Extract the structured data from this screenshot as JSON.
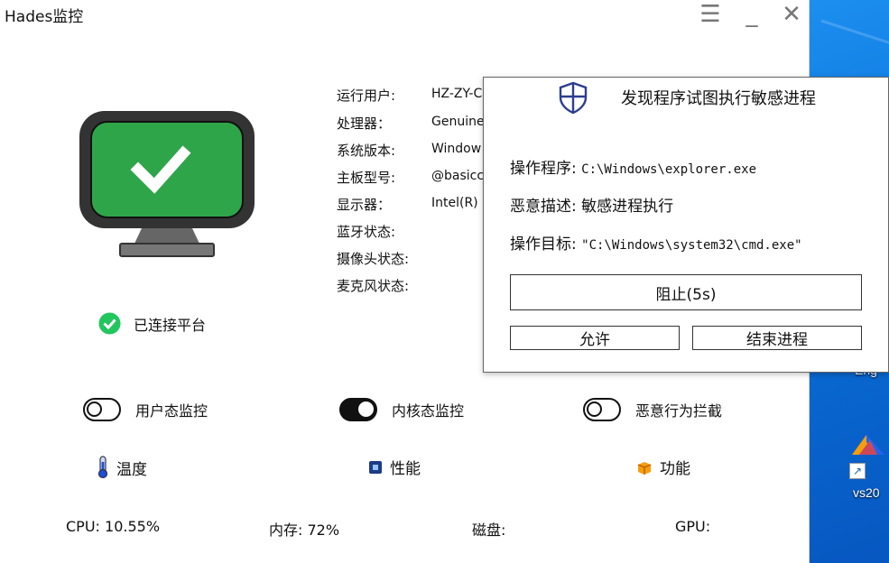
{
  "window": {
    "title": "Hades监控"
  },
  "window_controls": {
    "menu": "☰",
    "minimize": "_",
    "close": "✕"
  },
  "status": {
    "label": "已连接平台",
    "color": "#22c55e"
  },
  "monitor": {
    "screen_color": "#2fa54a"
  },
  "system_info": [
    {
      "label": "运行用户:",
      "value": "HZ-ZY-C"
    },
    {
      "label": "处理器：",
      "value": "Genuine"
    },
    {
      "label": "系统版本:",
      "value": "Window"
    },
    {
      "label": "主板型号:",
      "value": "@basicc"
    },
    {
      "label": "显示器：",
      "value": "Intel(R)"
    },
    {
      "label": "蓝牙状态:",
      "value": ""
    },
    {
      "label": "摄像头状态:",
      "value": ""
    },
    {
      "label": "麦克风状态:",
      "value": ""
    }
  ],
  "toggles": [
    {
      "label": "用户态监控",
      "on": false
    },
    {
      "label": "内核态监控",
      "on": true
    },
    {
      "label": "恶意行为拦截",
      "on": false
    }
  ],
  "tabs": [
    {
      "label": "温度",
      "icon": "thermometer-icon"
    },
    {
      "label": "性能",
      "icon": "chip-icon"
    },
    {
      "label": "功能",
      "icon": "box-icon"
    }
  ],
  "stats": [
    {
      "text": "CPU: 10.55%"
    },
    {
      "text": "内存: 72%"
    },
    {
      "text": "磁盘:"
    },
    {
      "text": "GPU:"
    }
  ],
  "dialog": {
    "title": "发现程序试图执行敏感进程",
    "rows": [
      {
        "label": "操作程序:",
        "value": "C:\\Windows\\explorer.exe"
      },
      {
        "label": "恶意描述:",
        "value": "敏感进程执行"
      },
      {
        "label": "操作目标:",
        "value": "\"C:\\Windows\\system32\\cmd.exe\""
      }
    ],
    "block_label": "阻止(5s)",
    "allow_label": "允许",
    "end_label": "结束进程"
  },
  "desktop": {
    "label_partial": "Eng",
    "shortcut_label": "vs20"
  }
}
